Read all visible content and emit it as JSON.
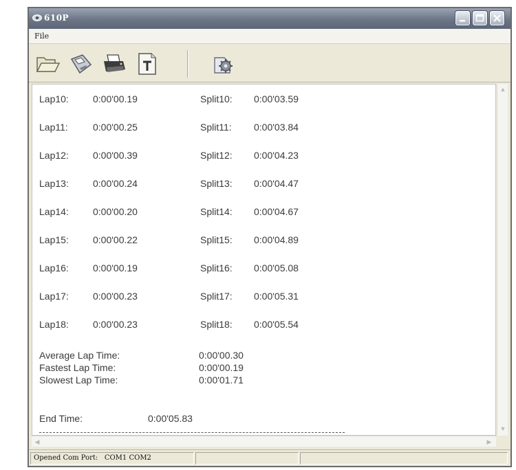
{
  "window": {
    "title": "610P",
    "menu": {
      "file": "File"
    }
  },
  "laps": [
    {
      "lap_label": "Lap10:",
      "lap_time": "0:00'00.19",
      "split_label": "Split10:",
      "split_time": "0:00'03.59"
    },
    {
      "lap_label": "Lap11:",
      "lap_time": "0:00'00.25",
      "split_label": "Split11:",
      "split_time": "0:00'03.84"
    },
    {
      "lap_label": "Lap12:",
      "lap_time": "0:00'00.39",
      "split_label": "Split12:",
      "split_time": "0:00'04.23"
    },
    {
      "lap_label": "Lap13:",
      "lap_time": "0:00'00.24",
      "split_label": "Split13:",
      "split_time": "0:00'04.47"
    },
    {
      "lap_label": "Lap14:",
      "lap_time": "0:00'00.20",
      "split_label": "Split14:",
      "split_time": "0:00'04.67"
    },
    {
      "lap_label": "Lap15:",
      "lap_time": "0:00'00.22",
      "split_label": "Split15:",
      "split_time": "0:00'04.89"
    },
    {
      "lap_label": "Lap16:",
      "lap_time": "0:00'00.19",
      "split_label": "Split16:",
      "split_time": "0:00'05.08"
    },
    {
      "lap_label": "Lap17:",
      "lap_time": "0:00'00.23",
      "split_label": "Split17:",
      "split_time": "0:00'05.31"
    },
    {
      "lap_label": "Lap18:",
      "lap_time": "0:00'00.23",
      "split_label": "Split18:",
      "split_time": "0:00'05.54"
    }
  ],
  "stats": {
    "average_label": "Average Lap Time:",
    "average_value": "0:00'00.30",
    "fastest_label": "Fastest Lap Time:",
    "fastest_value": "0:00'00.19",
    "slowest_label": "Slowest Lap Time:",
    "slowest_value": "0:00'01.71"
  },
  "end": {
    "label": "End Time:",
    "value": "0:00'05.83"
  },
  "status": {
    "text": "Opened Com Port:   COM1 COM2"
  },
  "toolbar": {
    "icons": [
      "open-folder-icon",
      "save-disk-icon",
      "printer-icon",
      "text-document-icon",
      "settings-gear-icon"
    ]
  }
}
